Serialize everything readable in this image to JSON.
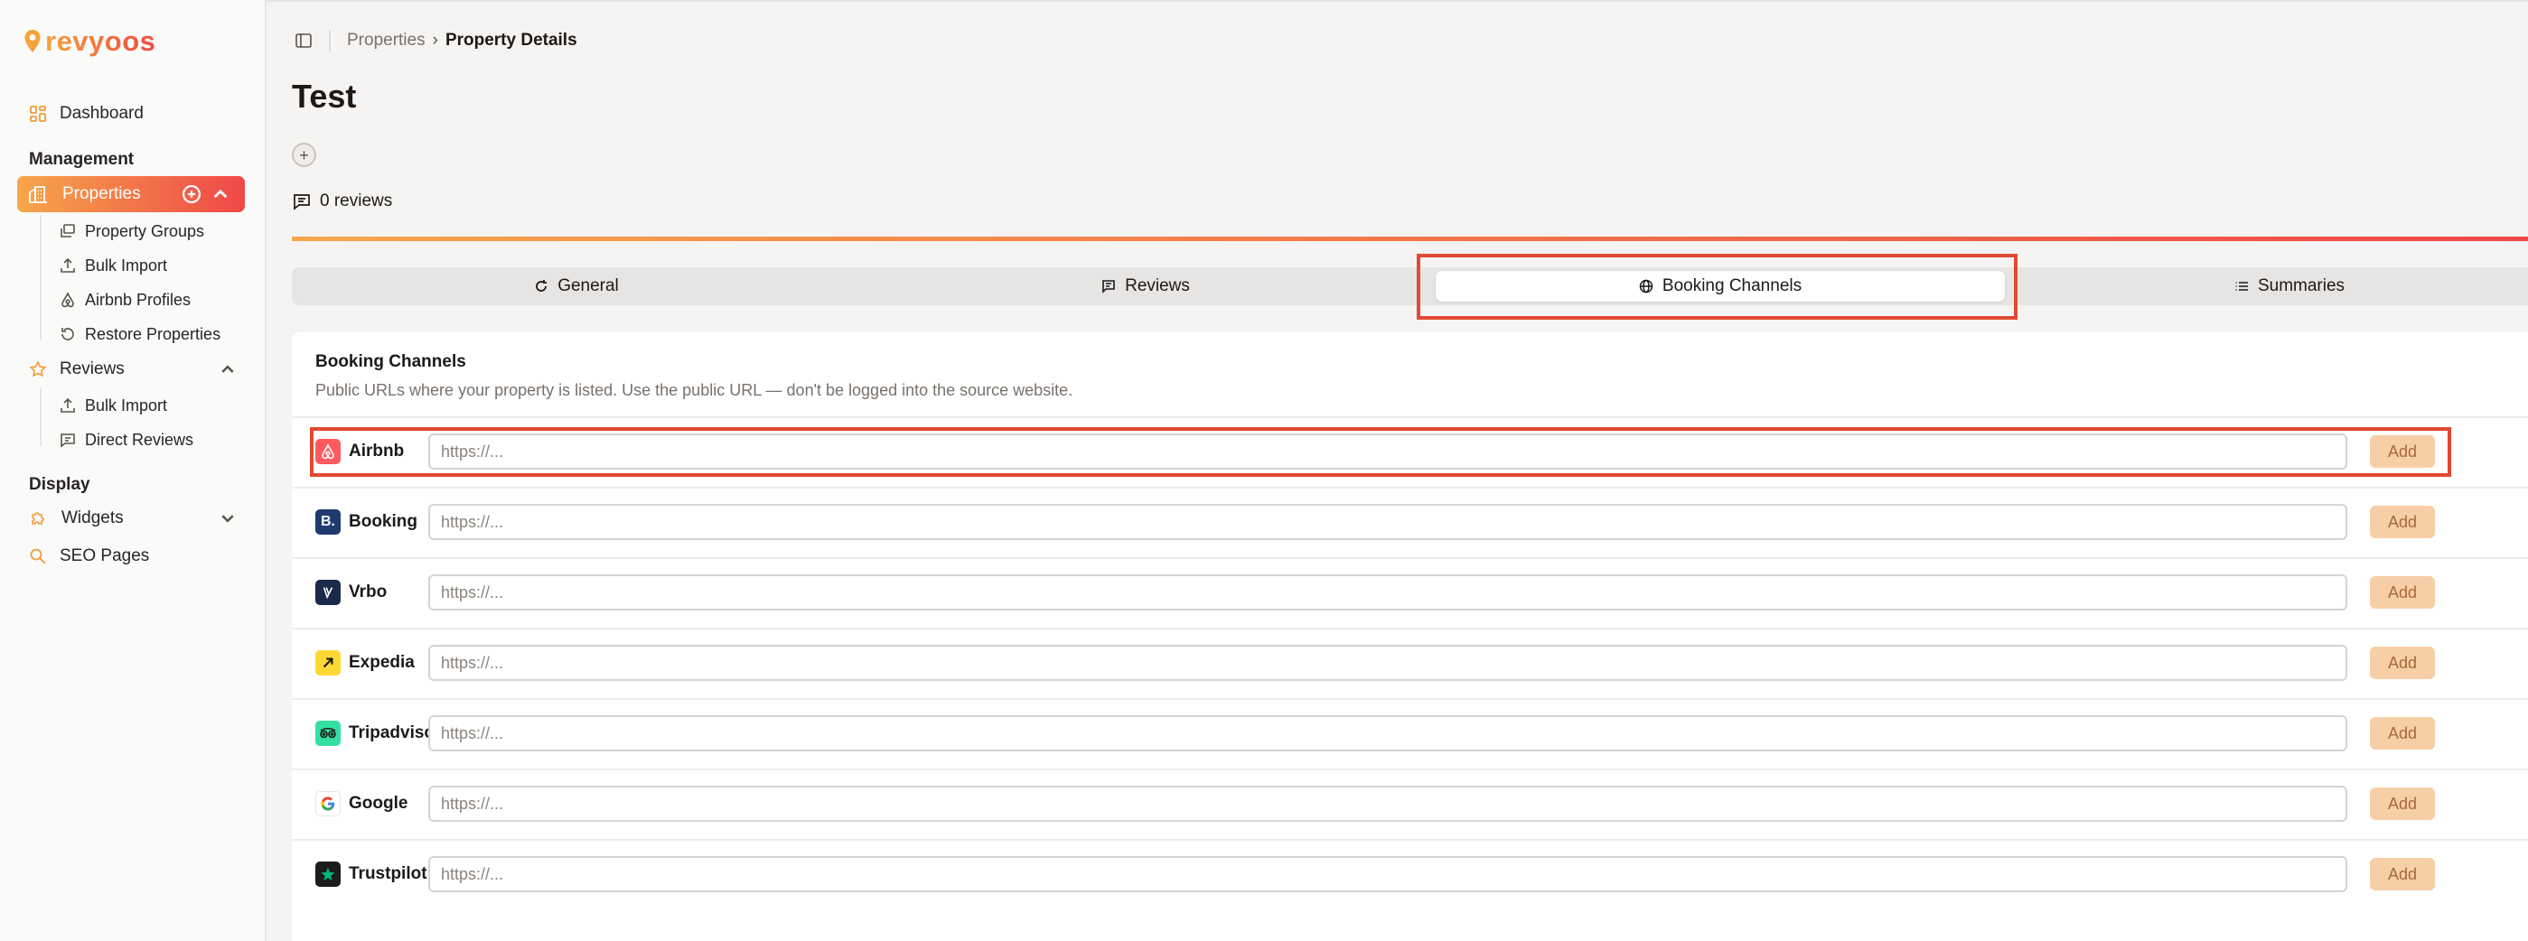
{
  "app": {
    "logo": "revyoos"
  },
  "colors": {
    "accent_start": "#f7a64a",
    "accent_end": "#ef4848",
    "highlight": "#e04a32"
  },
  "sidebar": {
    "dashboard": "Dashboard",
    "management_label": "Management",
    "properties": "Properties",
    "properties_sub": [
      "Property Groups",
      "Bulk Import",
      "Airbnb Profiles",
      "Restore Properties"
    ],
    "reviews": "Reviews",
    "reviews_sub": [
      "Bulk Import",
      "Direct Reviews"
    ],
    "display_label": "Display",
    "widgets": "Widgets",
    "seo_pages": "SEO Pages"
  },
  "breadcrumb": {
    "parent": "Properties",
    "current": "Property Details"
  },
  "page": {
    "title": "Test",
    "add_tag": "+",
    "reviews_count": "0 reviews"
  },
  "tabs": [
    {
      "label": "General",
      "icon": "refresh-icon"
    },
    {
      "label": "Reviews",
      "icon": "message-icon"
    },
    {
      "label": "Booking Channels",
      "icon": "globe-icon",
      "active": true
    },
    {
      "label": "Summaries",
      "icon": "list-icon"
    }
  ],
  "booking": {
    "title": "Booking Channels",
    "subtitle": "Public URLs where your property is listed. Use the public URL — don't be logged into the source website.",
    "placeholder": "https://...",
    "add_label": "Add",
    "channels": [
      {
        "name": "Airbnb",
        "icon": "airbnb-icon",
        "color": "#ff5a5f"
      },
      {
        "name": "Booking",
        "icon": "booking-icon",
        "color": "#1f3a6e"
      },
      {
        "name": "Vrbo",
        "icon": "vrbo-icon",
        "color": "#1b2a4a"
      },
      {
        "name": "Expedia",
        "icon": "expedia-icon",
        "color": "#fdd835"
      },
      {
        "name": "Tripadvisor",
        "icon": "tripadvisor-icon",
        "color": "#34e0a1"
      },
      {
        "name": "Google",
        "icon": "google-icon",
        "color": "#ffffff"
      },
      {
        "name": "Trustpilot",
        "icon": "trustpilot-icon",
        "color": "#1c1c1c"
      }
    ]
  }
}
